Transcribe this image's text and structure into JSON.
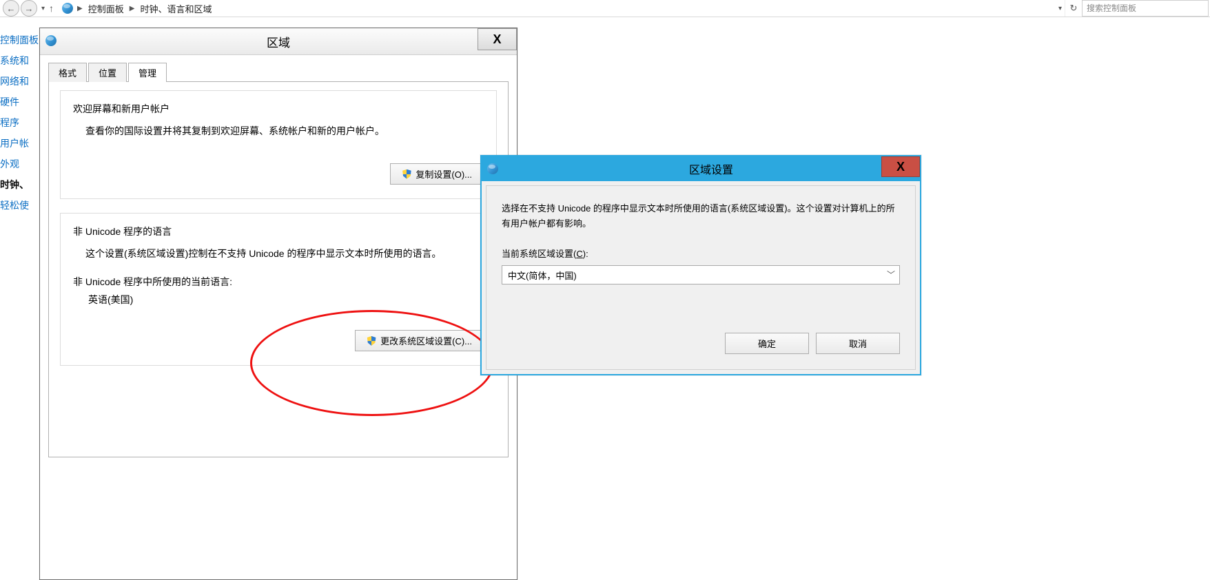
{
  "topbar": {
    "crumb1": "控制面板",
    "crumb2": "时钟、语言和区域",
    "search_placeholder": "搜索控制面板",
    "nav_down": "▾",
    "nav_refresh": "↻"
  },
  "sidebar": {
    "items": [
      "控制面板",
      "系统和",
      "网络和",
      "硬件",
      "程序",
      "用户帐",
      "外观",
      "时钟、",
      "轻松使"
    ]
  },
  "region_dialog": {
    "title": "区域",
    "close": "X",
    "tabs": {
      "format": "格式",
      "location": "位置",
      "admin": "管理"
    },
    "group1": {
      "title": "欢迎屏幕和新用户帐户",
      "desc": "查看你的国际设置并将其复制到欢迎屏幕、系统帐户和新的用户帐户。",
      "button": "复制设置(O)..."
    },
    "group2": {
      "title": "非 Unicode 程序的语言",
      "desc": "这个设置(系统区域设置)控制在不支持 Unicode 的程序中显示文本时所使用的语言。",
      "sub": "非 Unicode 程序中所使用的当前语言:",
      "value": "英语(美国)",
      "button": "更改系统区域设置(C)..."
    }
  },
  "locale_dialog": {
    "title": "区域设置",
    "close": "X",
    "desc": "选择在不支持 Unicode 的程序中显示文本时所使用的语言(系统区域设置)。这个设置对计算机上的所有用户帐户都有影响。",
    "label_pre": "当前系统区域设置(",
    "label_u": "C",
    "label_post": "):",
    "selected": "中文(简体，中国)",
    "ok": "确定",
    "cancel": "取消"
  }
}
